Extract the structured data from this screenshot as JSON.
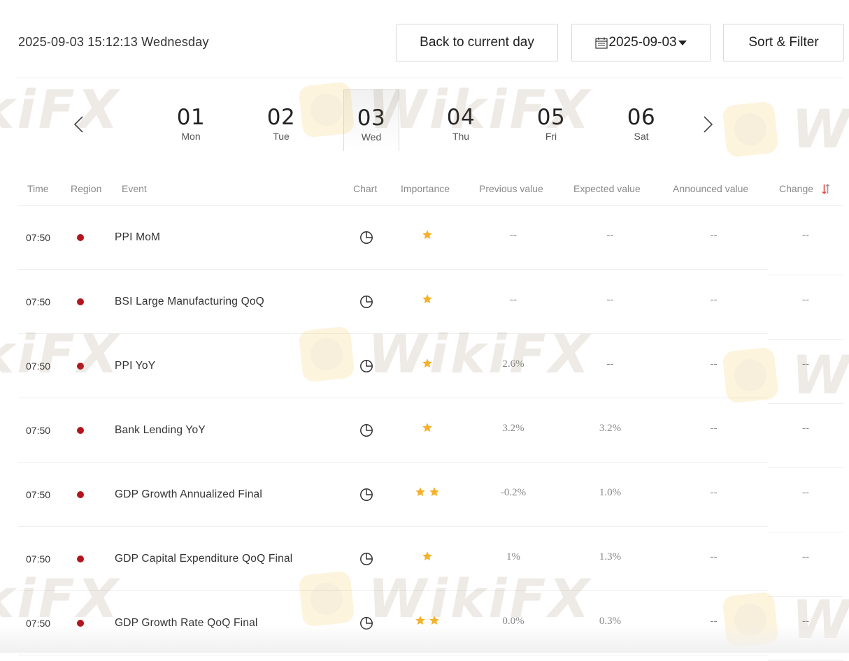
{
  "header": {
    "datetime": "2025-09-03 15:12:13 Wednesday",
    "back_label": "Back to current day",
    "date_label": "2025-09-03",
    "sort_label": "Sort & Filter"
  },
  "days": [
    {
      "num": "01",
      "weekday": "Mon",
      "selected": false
    },
    {
      "num": "02",
      "weekday": "Tue",
      "selected": false
    },
    {
      "num": "03",
      "weekday": "Wed",
      "selected": true
    },
    {
      "num": "04",
      "weekday": "Thu",
      "selected": false
    },
    {
      "num": "05",
      "weekday": "Fri",
      "selected": false
    },
    {
      "num": "06",
      "weekday": "Sat",
      "selected": false
    }
  ],
  "table": {
    "headers": {
      "time": "Time",
      "region": "Region",
      "event": "Event",
      "chart": "Chart",
      "importance": "Importance",
      "previous": "Previous value",
      "expected": "Expected value",
      "announced": "Announced value",
      "change": "Change"
    },
    "rows": [
      {
        "time": "07:50",
        "region_icon": "japan-flag-icon",
        "event": "PPI MoM",
        "stars": 1,
        "previous": "--",
        "expected": "--",
        "announced": "--",
        "change": "--"
      },
      {
        "time": "07:50",
        "region_icon": "japan-flag-icon",
        "event": "BSI Large Manufacturing QoQ",
        "stars": 1,
        "previous": "--",
        "expected": "--",
        "announced": "--",
        "change": "--"
      },
      {
        "time": "07:50",
        "region_icon": "japan-flag-icon",
        "event": "PPI YoY",
        "stars": 1,
        "previous": "2.6%",
        "expected": "--",
        "announced": "--",
        "change": "--"
      },
      {
        "time": "07:50",
        "region_icon": "japan-flag-icon",
        "event": "Bank Lending YoY",
        "stars": 1,
        "previous": "3.2%",
        "expected": "3.2%",
        "announced": "--",
        "change": "--"
      },
      {
        "time": "07:50",
        "region_icon": "japan-flag-icon",
        "event": "GDP Growth Annualized Final",
        "stars": 2,
        "previous": "-0.2%",
        "expected": "1.0%",
        "announced": "--",
        "change": "--"
      },
      {
        "time": "07:50",
        "region_icon": "japan-flag-icon",
        "event": "GDP Capital Expenditure QoQ Final",
        "stars": 1,
        "previous": "1%",
        "expected": "1.3%",
        "announced": "--",
        "change": "--"
      },
      {
        "time": "07:50",
        "region_icon": "japan-flag-icon",
        "event": "GDP Growth Rate QoQ Final",
        "stars": 2,
        "previous": "0.0%",
        "expected": "0.3%",
        "announced": "--",
        "change": "--"
      }
    ]
  },
  "colors": {
    "star": "#f4b12a",
    "flag_red": "#b3151d",
    "selected_day_bg": "#f1f1f1"
  },
  "watermark": "WikiFX"
}
